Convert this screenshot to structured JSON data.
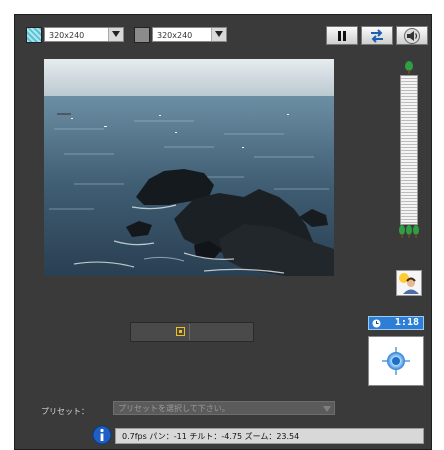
{
  "toolbar": {
    "resolution_a": "320x240",
    "resolution_b": "320x240",
    "pause_icon": "pause-icon",
    "swap_icon": "swap-arrows-icon",
    "sound_icon": "speaker-icon"
  },
  "camera": {
    "scene": "coastal rocks and sea"
  },
  "zoom": {
    "in_icon": "tree-icon",
    "out_icon": "forest-icon"
  },
  "clock": {
    "time": "1:18"
  },
  "preset": {
    "label": "プリセット：",
    "placeholder": "プリセットを選択して下さい。"
  },
  "status": {
    "text": "0.7fps パン：-11 チルト：-4.75 ズーム：23.54"
  },
  "colors": {
    "panel": "#3a3a3a",
    "accent_blue": "#2d7fd6",
    "pan_bar": "#4a4a4a",
    "pan_marker": "#f0c020"
  }
}
